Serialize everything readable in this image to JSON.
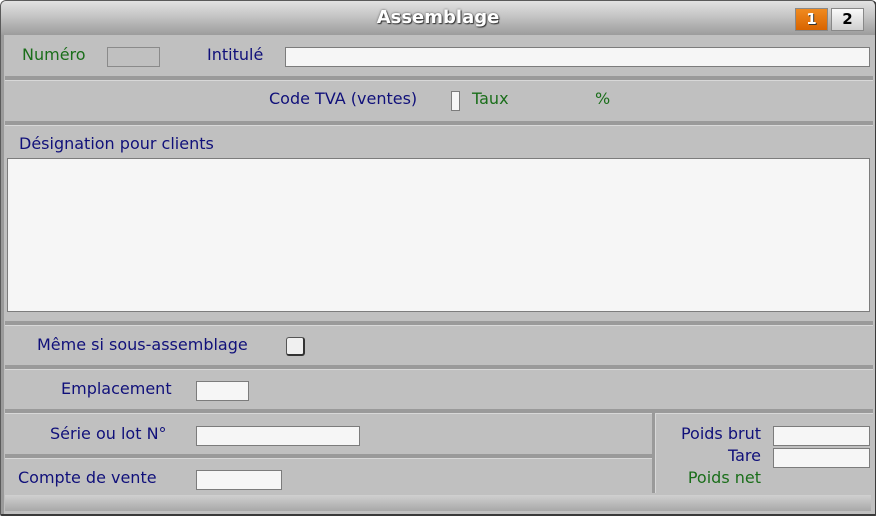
{
  "window": {
    "title": "Assemblage",
    "pages": [
      {
        "label": "1",
        "active": true
      },
      {
        "label": "2",
        "active": false
      }
    ]
  },
  "form": {
    "numero": {
      "label": "Numéro",
      "value": ""
    },
    "intitule": {
      "label": "Intitulé",
      "value": ""
    },
    "code_tva": {
      "label": "Code TVA (ventes)",
      "value": ""
    },
    "taux": {
      "label": "Taux",
      "unit": "%"
    },
    "designation": {
      "label": "Désignation pour clients",
      "value": ""
    },
    "meme_si_sous_assemblage": {
      "label": "Même si sous-assemblage",
      "checked": false
    },
    "emplacement": {
      "label": "Emplacement",
      "value": ""
    },
    "serie_lot": {
      "label": "Série ou lot N°",
      "value": ""
    },
    "compte_vente": {
      "label": "Compte de vente",
      "value": ""
    },
    "poids_brut": {
      "label": "Poids brut",
      "value": ""
    },
    "tare": {
      "label": "Tare",
      "value": ""
    },
    "poids_net": {
      "label": "Poids net"
    }
  },
  "colors": {
    "active_page": "#e87800",
    "label_blue": "#10107a",
    "label_green": "#1a6e1a",
    "background": "#c0c0c0"
  }
}
